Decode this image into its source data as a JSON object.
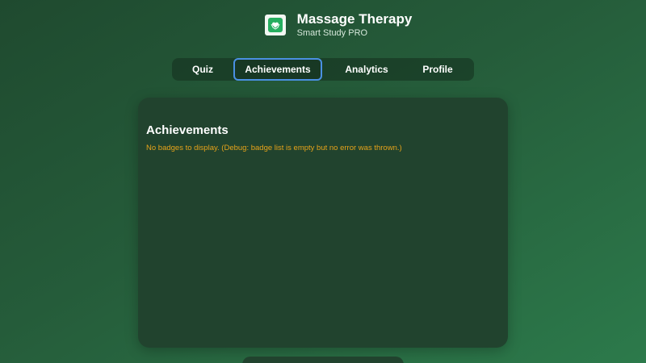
{
  "header": {
    "title": "Massage Therapy",
    "subtitle": "Smart Study PRO",
    "logo_icon": "heart-hands-icon"
  },
  "nav": {
    "items": [
      {
        "label": "Quiz",
        "active": false
      },
      {
        "label": "Achievements",
        "active": true
      },
      {
        "label": "Analytics",
        "active": false
      },
      {
        "label": "Profile",
        "active": false
      }
    ]
  },
  "main": {
    "title": "Achievements",
    "message": "No badges to display. (Debug: badge list is empty but no error was thrown.)"
  },
  "colors": {
    "accent": "#4a90e2",
    "warning_text": "#e6a31a",
    "logo_green": "#27ae60"
  }
}
